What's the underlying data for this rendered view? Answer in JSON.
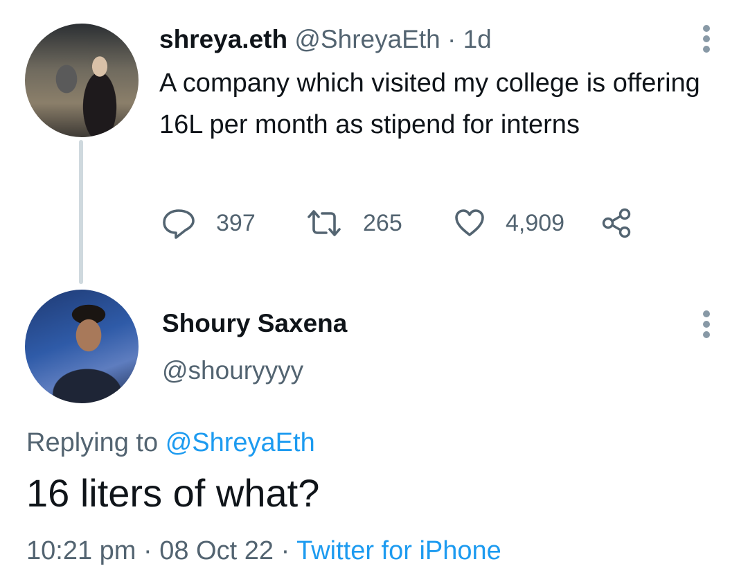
{
  "tweet": {
    "author_name": "shreya.eth",
    "author_handle": "@ShreyaEth",
    "separator": "·",
    "age": "1d",
    "text": "A company which visited my college is offering 16L per month as stipend for interns",
    "actions": {
      "replies": "397",
      "retweets": "265",
      "likes": "4,909"
    },
    "avatar_icon": "profile-photo"
  },
  "reply": {
    "author_name": "Shoury Saxena",
    "author_handle": "@shouryyyy",
    "replying_prefix": "Replying to",
    "replying_to": "@ShreyaEth",
    "text": "16 liters of what?",
    "time": "10:21 pm",
    "separator": "·",
    "date": "08 Oct 22",
    "source": "Twitter for iPhone",
    "avatar_icon": "profile-photo"
  },
  "colors": {
    "link": "#1d9bf0",
    "secondary_text": "#536471",
    "thread_line": "#cfd9de"
  }
}
